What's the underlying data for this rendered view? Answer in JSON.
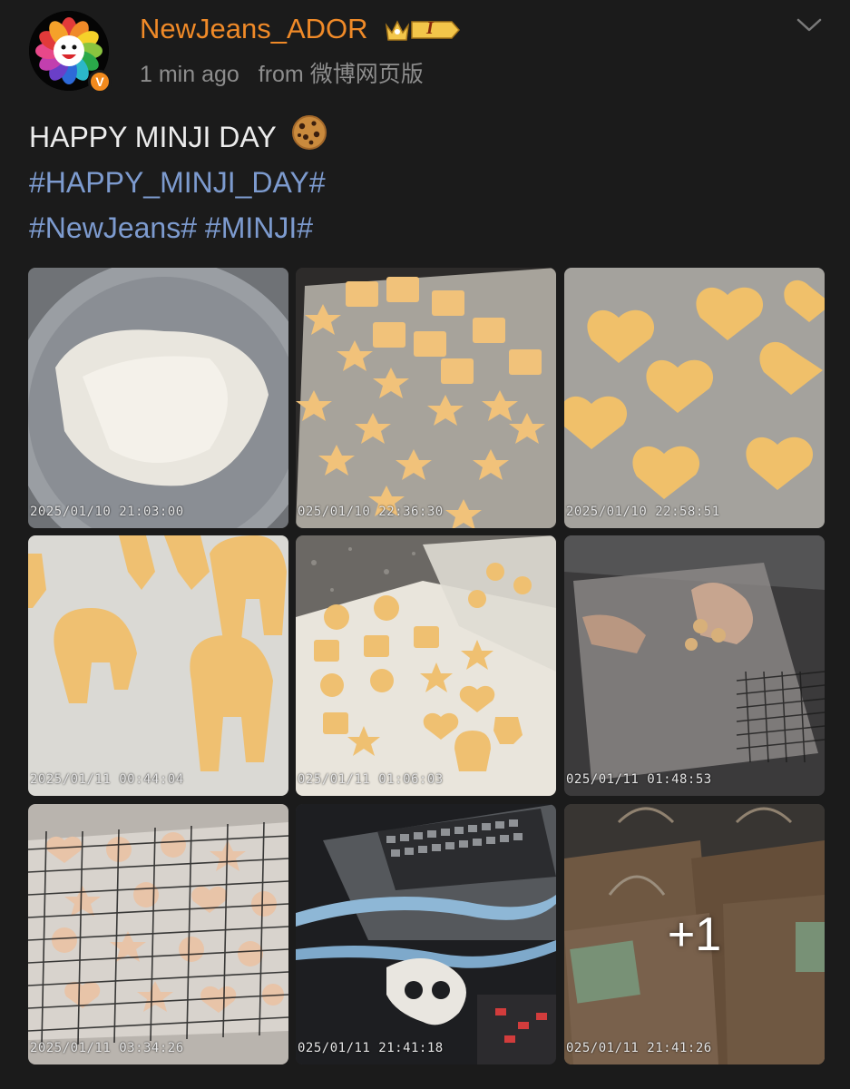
{
  "post": {
    "username": "NewJeans_ADOR",
    "badge_level": "I",
    "verified_mark": "V",
    "timestamp": "1 min ago",
    "from_label": "from",
    "source": "微博网页版",
    "text_title": "HAPPY MINJI DAY",
    "text_emoji": "cookie-emoji",
    "hashtags": [
      "#HAPPY_MINJI_DAY#",
      "#NewJeans#",
      "#MINJI#"
    ],
    "accent_color": "#f08a28",
    "hashtag_color": "#7d9bcf"
  },
  "photos": [
    {
      "subject": "flour in sieve",
      "stamp": "2025/01/10 21:03:00"
    },
    {
      "subject": "cut cookie dough stars and squares",
      "stamp": "025/01/10 22:36:30"
    },
    {
      "subject": "heart cookie dough",
      "stamp": "2025/01/10 22:58:51"
    },
    {
      "subject": "bunny cookie dough",
      "stamp": "2025/01/11 00:44:04"
    },
    {
      "subject": "mixed cookie shapes on parchment",
      "stamp": "025/01/11 01:06:03"
    },
    {
      "subject": "hands packing cookies",
      "stamp": "025/01/11 01:48:53"
    },
    {
      "subject": "cookies on cooling rack",
      "stamp": "2025/01/11 03:34:26"
    },
    {
      "subject": "ribbon and laptop",
      "stamp": "025/01/11 21:41:18"
    },
    {
      "subject": "paper gift bags",
      "stamp": "025/01/11 21:41:26",
      "overlay": "+1"
    }
  ]
}
